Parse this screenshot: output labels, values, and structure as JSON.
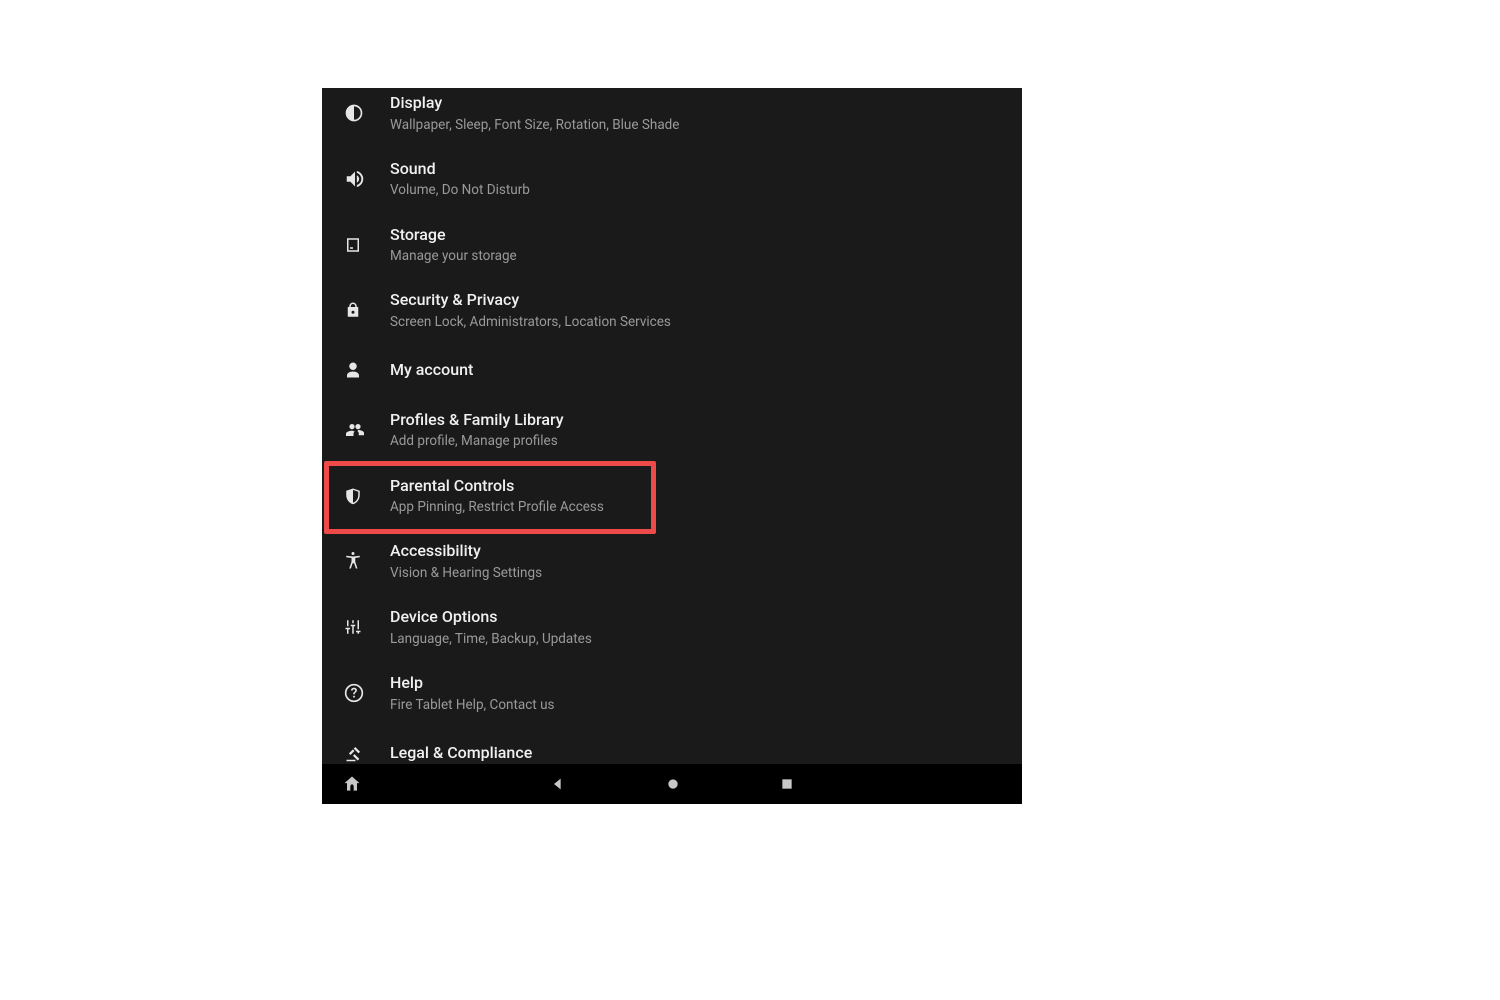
{
  "settings": {
    "items": [
      {
        "icon": "display-icon",
        "title": "Display",
        "subtitle": "Wallpaper, Sleep, Font Size, Rotation, Blue Shade"
      },
      {
        "icon": "sound-icon",
        "title": "Sound",
        "subtitle": "Volume, Do Not Disturb"
      },
      {
        "icon": "storage-icon",
        "title": "Storage",
        "subtitle": "Manage your storage"
      },
      {
        "icon": "security-icon",
        "title": "Security & Privacy",
        "subtitle": "Screen Lock, Administrators, Location Services"
      },
      {
        "icon": "account-icon",
        "title": "My account",
        "subtitle": ""
      },
      {
        "icon": "profiles-icon",
        "title": "Profiles & Family Library",
        "subtitle": "Add profile, Manage profiles"
      },
      {
        "icon": "parental-icon",
        "title": "Parental Controls",
        "subtitle": "App Pinning, Restrict Profile Access"
      },
      {
        "icon": "accessibility-icon",
        "title": "Accessibility",
        "subtitle": "Vision & Hearing Settings"
      },
      {
        "icon": "device-options-icon",
        "title": "Device Options",
        "subtitle": "Language, Time, Backup, Updates"
      },
      {
        "icon": "help-icon",
        "title": "Help",
        "subtitle": "Fire Tablet Help, Contact us"
      },
      {
        "icon": "legal-icon",
        "title": "Legal & Compliance",
        "subtitle": ""
      }
    ],
    "highlighted_index": 6
  },
  "highlight_color": "#ef4a4a"
}
